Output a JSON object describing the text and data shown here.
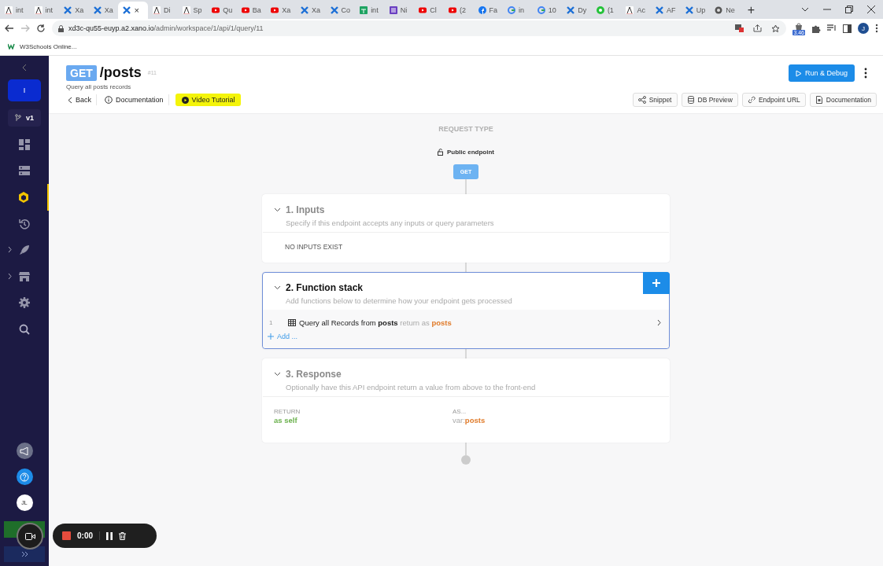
{
  "browser": {
    "tabs": [
      {
        "label": "int",
        "kind": "letter",
        "selected": false
      },
      {
        "label": "int",
        "kind": "letter",
        "selected": false
      },
      {
        "label": "Xa",
        "kind": "xano",
        "selected": false
      },
      {
        "label": "Xa",
        "kind": "xano",
        "selected": false
      },
      {
        "label": "×",
        "kind": "xano",
        "selected": true
      },
      {
        "label": "Di",
        "kind": "letter",
        "selected": false
      },
      {
        "label": "Sp",
        "kind": "letter",
        "selected": false
      },
      {
        "label": "Qu",
        "kind": "video",
        "selected": false
      },
      {
        "label": "Ba",
        "kind": "video",
        "selected": false
      },
      {
        "label": "Xa",
        "kind": "video",
        "selected": false
      },
      {
        "label": "Xa",
        "kind": "xano",
        "selected": false
      },
      {
        "label": "Co",
        "kind": "xano",
        "selected": false
      },
      {
        "label": "int",
        "kind": "sheet",
        "selected": false
      },
      {
        "label": "Ni",
        "kind": "form",
        "selected": false
      },
      {
        "label": "Cl",
        "kind": "video",
        "selected": false
      },
      {
        "label": "(2",
        "kind": "video",
        "selected": false
      },
      {
        "label": "Fa",
        "kind": "social",
        "selected": false
      },
      {
        "label": "in",
        "kind": "search",
        "selected": false
      },
      {
        "label": "10",
        "kind": "search",
        "selected": false
      },
      {
        "label": "Dy",
        "kind": "xano",
        "selected": false
      },
      {
        "label": "(1",
        "kind": "chat",
        "selected": false
      },
      {
        "label": "Ac",
        "kind": "letter",
        "selected": false
      },
      {
        "label": "AF",
        "kind": "xano",
        "selected": false
      },
      {
        "label": "Up",
        "kind": "xano",
        "selected": false
      },
      {
        "label": "Ne",
        "kind": "globe",
        "selected": false
      }
    ],
    "new_tab": "+",
    "address": {
      "host": "xd3c-qu55-euyp.a2.xano.io",
      "path": "/admin/workspace/1/api/1/query/11"
    },
    "extension_badge": "3.46",
    "profile": "J",
    "bookmarks": [
      "W3Schools Online..."
    ]
  },
  "sidebar": {
    "workspace": "I",
    "branch": "v1",
    "items": [
      {
        "kind": "dashboard",
        "selected": false,
        "submenu": false
      },
      {
        "kind": "database",
        "selected": false,
        "submenu": false
      },
      {
        "kind": "api",
        "selected": true,
        "submenu": false
      },
      {
        "kind": "history",
        "selected": false,
        "submenu": false
      },
      {
        "kind": "addons",
        "selected": false,
        "submenu": true
      },
      {
        "kind": "market",
        "selected": false,
        "submenu": true
      },
      {
        "kind": "settings",
        "selected": false,
        "submenu": false
      },
      {
        "kind": "search",
        "selected": false,
        "submenu": false
      }
    ],
    "avatar": "JL"
  },
  "recorder": {
    "time": "0:00"
  },
  "endpoint": {
    "method": "GET",
    "path": "/posts",
    "id": "#11",
    "description": "Query all posts records",
    "links": [
      {
        "kind": "back",
        "label": "Back"
      },
      {
        "kind": "docs",
        "label": "Documentation"
      },
      {
        "kind": "video",
        "label": "Video Tutorial"
      }
    ],
    "run_button": "Run & Debug",
    "tools": [
      {
        "kind": "snippet",
        "label": "Snippet"
      },
      {
        "kind": "db",
        "label": "DB Preview"
      },
      {
        "kind": "link",
        "label": "Endpoint URL"
      },
      {
        "kind": "doc",
        "label": "Documentation"
      }
    ]
  },
  "canvas": {
    "request_type_label": "REQUEST TYPE",
    "access": "Public endpoint",
    "method": "GET",
    "sections": [
      {
        "kind": "inputs",
        "title": "1. Inputs",
        "subtitle": "Specify if this endpoint accepts any inputs or query parameters",
        "selected": false,
        "empty_text": "NO INPUTS EXIST"
      },
      {
        "kind": "stack",
        "title": "2. Function stack",
        "subtitle": "Add functions below to determine how your endpoint gets processed",
        "selected": true,
        "steps": [
          {
            "index": "1",
            "action": "Query all Records from",
            "table": "posts",
            "return_label": "return as",
            "variable": "posts"
          }
        ],
        "add_label": "Add ..."
      },
      {
        "kind": "response",
        "title": "3. Response",
        "subtitle": "Optionally have this API endpoint return a value from above to the front-end",
        "selected": false,
        "return_label": "RETURN",
        "return_value": "as self",
        "as_label": "AS...",
        "var_prefix": "var:",
        "var_name": "posts"
      }
    ]
  }
}
